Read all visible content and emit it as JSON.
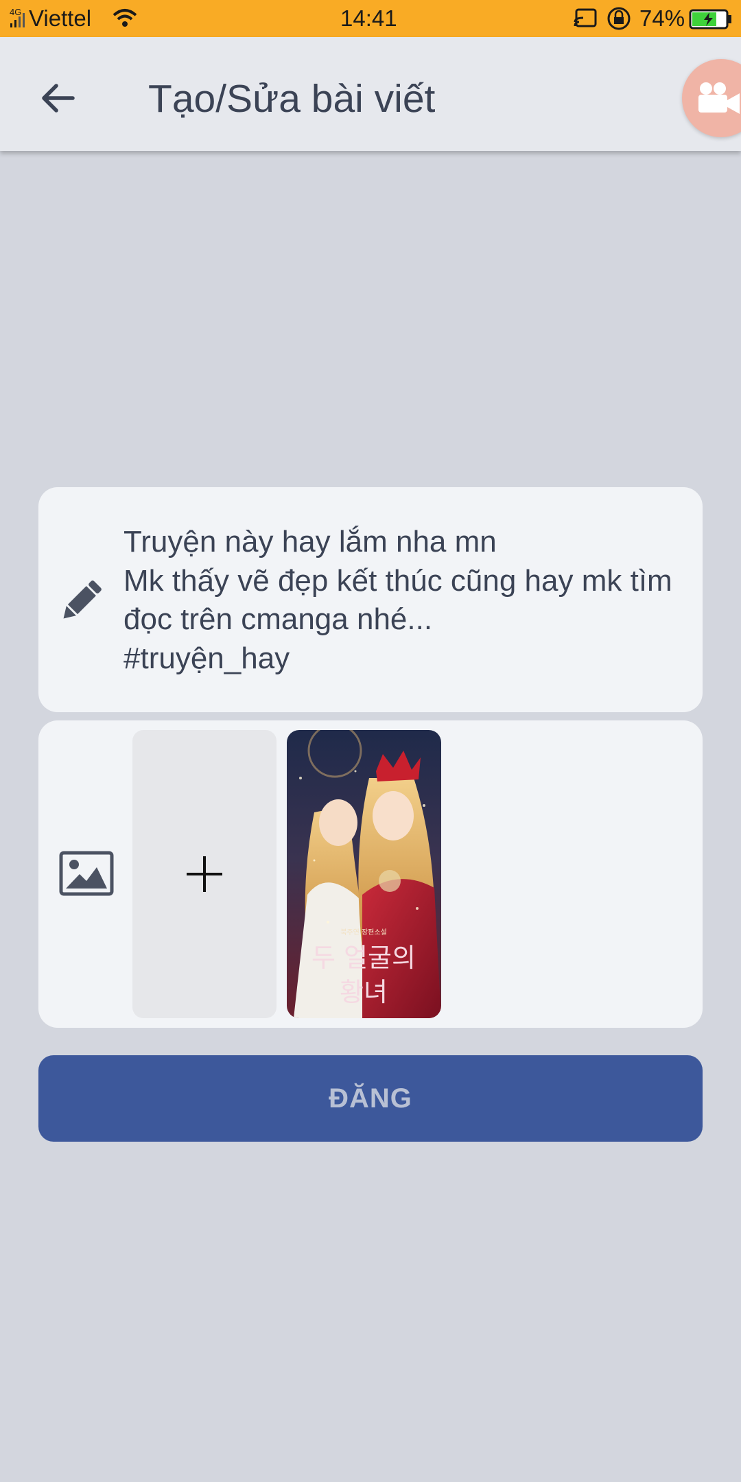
{
  "status_bar": {
    "network_type": "4G",
    "carrier": "Viettel",
    "time": "14:41",
    "battery": "74%"
  },
  "header": {
    "title": "Tạo/Sửa bài viết"
  },
  "post": {
    "text": "Truyện này hay lắm nha mn\nMk thấy vẽ đẹp kết thúc cũng hay mk tìm đọc trên cmanga nhé...\n#truyện_hay"
  },
  "cover": {
    "subtitle": "북주연 장편소설",
    "title_line1": "두 얼굴의",
    "title_line2": "황녀"
  },
  "actions": {
    "submit_label": "ĐĂNG"
  },
  "colors": {
    "status_bar": "#f9ab25",
    "app_bar": "#e6e8ed",
    "background": "#d3d6de",
    "card": "#f2f4f7",
    "primary_button": "#3d589b",
    "text": "#3b4355",
    "fab": "#f0b4a6"
  },
  "icons": {
    "back": "arrow-left-icon",
    "fab": "video-camera-icon",
    "text_field": "pencil-icon",
    "media_field": "image-icon",
    "add": "plus-icon"
  }
}
